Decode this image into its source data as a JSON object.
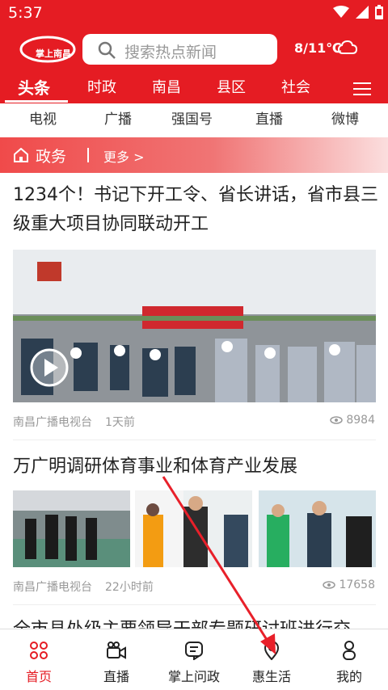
{
  "status_bar": {
    "time": "5:37"
  },
  "header": {
    "logo_text": "掌上南昌",
    "search_placeholder": "搜索热点新闻",
    "weather": "8/11℃"
  },
  "tabs": [
    "头条",
    "时政",
    "南昌",
    "县区",
    "社会"
  ],
  "sub_nav": [
    "电视",
    "广播",
    "强国号",
    "直播",
    "微博"
  ],
  "section": {
    "title": "政务",
    "more": "更多 >"
  },
  "articles": [
    {
      "title": "1234个！书记下开工令、省长讲话，省市县三级重大项目协同联动开工",
      "source": "南昌广播电视台",
      "time": "1天前",
      "views": "8984"
    },
    {
      "title": "万广明调研体育事业和体育产业发展",
      "source": "南昌广播电视台",
      "time": "22小时前",
      "views": "17658"
    },
    {
      "title": "全市县处级主要领导干部专题研讨班进行交"
    }
  ],
  "bottom_nav": [
    {
      "label": "首页",
      "icon": "home-grid-icon"
    },
    {
      "label": "直播",
      "icon": "video-camera-icon"
    },
    {
      "label": "掌上问政",
      "icon": "chat-icon"
    },
    {
      "label": "惠生活",
      "icon": "location-pin-icon"
    },
    {
      "label": "我的",
      "icon": "person-icon"
    }
  ],
  "colors": {
    "brand_red": "#e51c23",
    "annotation_arrow": "#e8202a"
  }
}
